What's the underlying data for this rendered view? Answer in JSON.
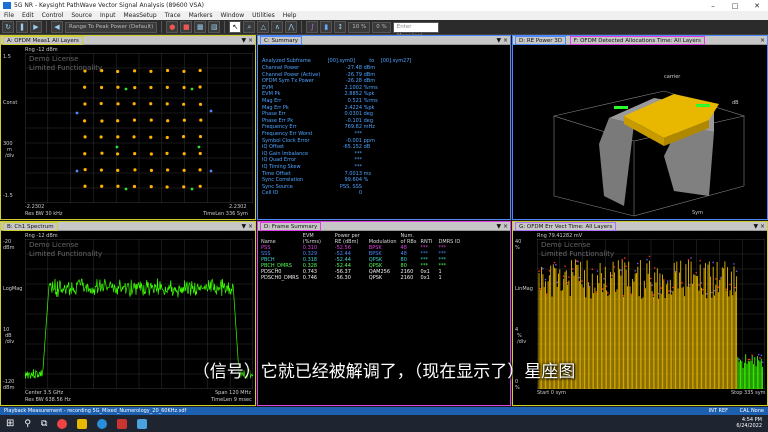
{
  "window": {
    "title": "5G NR - Keysight PathWave Vector Signal Analysis (89600 VSA)"
  },
  "menu": [
    "File",
    "Edit",
    "Control",
    "Source",
    "Input",
    "MeasSetup",
    "Trace",
    "Markers",
    "Window",
    "Utilities",
    "Help"
  ],
  "toolbar": {
    "range_label": "Range To Peak Power (Default)",
    "pct": "10 %",
    "zoom": "0 %",
    "search_placeholder": "Enter Meas/ical"
  },
  "panes": {
    "a": {
      "title": "A: OFDM Meas1 All Layers",
      "rng": "Rng -12 dBm",
      "license1": "Demo License",
      "license2": "Limited Functionality",
      "y_top": "1.5",
      "y_mid_top": "Const",
      "y_mid_val": "300",
      "y_mid_unit": "m",
      "y_mid_unit2": "/div",
      "y_bot": "-1.5",
      "x_left": "-2.2302",
      "x_right": "2.2302",
      "res": "Res BW 30 kHz",
      "timelen": "TimeLen 336  Sym"
    },
    "b": {
      "title": "B: Ch1 Spectrum",
      "rng": "Rng -12 dBm",
      "license1": "Demo License",
      "license2": "Limited Functionality",
      "y_top": "-20",
      "y_top_unit": "dBm",
      "y_mid": "LogMag",
      "y_mid_val": "10",
      "y_mid_unit": "dB",
      "y_mid_unit2": "/div",
      "y_bot": "-120",
      "y_bot_unit": "dBm",
      "center": "Center 3.5 GHz",
      "res": "Res BW 638.56 Hz",
      "span": "Span 120 MHz",
      "timelen": "TimeLen 9 msec"
    },
    "c": {
      "title": "C: Summary"
    },
    "d_title": "D: RE Power 3D",
    "f_title": "F: OFDM Detected Allocations Time: All Layers",
    "d": {
      "title": "D: Frame Summary"
    },
    "g": {
      "title": "G: OFDM Err Vect Time: All Layers",
      "rng": "Rng 79.41282 mV",
      "license1": "Demo License",
      "license2": "Limited Functionality",
      "y_top": "40",
      "y_top_unit": "%",
      "y_mid": "LinMag",
      "y_mid_val": "4",
      "y_mid_unit": "%",
      "y_mid_unit2": "/div",
      "y_bot": "0",
      "y_bot_unit": "%",
      "start": "Start 0  sym",
      "stop": "Stop 335  sym"
    }
  },
  "summary": {
    "header": {
      "label": "Analyzed  Subframe",
      "v1": "[00].sym0]",
      "v2": "to",
      "v3": "[00].sym27]"
    },
    "rows": [
      {
        "label": "Channel  Power",
        "value": "-27.48",
        "unit": "dBm"
      },
      {
        "label": "Channel  Power (Active)",
        "value": "-26.79",
        "unit": "dBm"
      },
      {
        "label": "OFDM Sym  Tx  Power",
        "value": "-26.28",
        "unit": "dBm"
      },
      {
        "label": "EVM",
        "value": "2.1002",
        "unit": "%rms"
      },
      {
        "label": "EVM Pk",
        "value": "2.8852",
        "unit": "%pk"
      },
      {
        "label": "Mag Err",
        "value": "0.521",
        "unit": "%rms"
      },
      {
        "label": "Mag Err  Pk",
        "value": "2.4224",
        "unit": "%pk"
      },
      {
        "label": "Phase  Err",
        "value": "0.0301",
        "unit": "deg"
      },
      {
        "label": "Phase  Err  Pk",
        "value": "-0.101",
        "unit": "deg"
      },
      {
        "label": "Frequency   Err",
        "value": "769.82",
        "unit": "mHz"
      },
      {
        "label": "Frequency   Err  Worst",
        "value": "***",
        "unit": ""
      },
      {
        "label": "Symbol  Clock  Error",
        "value": "-0.001",
        "unit": "ppm"
      },
      {
        "label": "IQ  Offset",
        "value": "-65.152",
        "unit": "dB"
      },
      {
        "label": "IQ  Gain  Imbalance",
        "value": "***",
        "unit": ""
      },
      {
        "label": "IQ  Quad  Error",
        "value": "***",
        "unit": ""
      },
      {
        "label": "IQ  Timing  Skew",
        "value": "***",
        "unit": ""
      },
      {
        "label": "Time  Offset",
        "value": "7.0013",
        "unit": "ms"
      },
      {
        "label": "Sync  Correlation",
        "value": "99.604",
        "unit": "%"
      },
      {
        "label": "Sync  Source",
        "value": "PSS,  SSS",
        "unit": ""
      },
      {
        "label": "Cell   ID",
        "value": "0",
        "unit": ""
      }
    ]
  },
  "frame_summary": {
    "headers": [
      "Name",
      "EVM (%rms)",
      "Power per RE (dBm)",
      "Modulation",
      "Num. of RBs",
      "RNTI",
      "DMRS ID"
    ],
    "rows": [
      {
        "name": "PSS",
        "evm": "0.310",
        "power": "-52.56",
        "mod": "BPSK",
        "rbs": "48",
        "rnti": "***",
        "dmrs": "***",
        "color": "#e040e0"
      },
      {
        "name": "SSS",
        "evm": "0.329",
        "power": "-52.44",
        "mod": "BPSK",
        "rbs": "48",
        "rnti": "***",
        "dmrs": "***",
        "color": "#4d88ff"
      },
      {
        "name": "PBCH",
        "evm": "0.318",
        "power": "-52.44",
        "mod": "QPSK",
        "rbs": "80",
        "rnti": "***",
        "dmrs": "***",
        "color": "#40d0d0"
      },
      {
        "name": "PBCH_DMRS",
        "evm": "0.328",
        "power": "-52.44",
        "mod": "QPSK",
        "rbs": "80",
        "rnti": "***",
        "dmrs": "***",
        "color": "#50ff50"
      },
      {
        "name": "PDSCH0",
        "evm": "0.743",
        "power": "-56.37",
        "mod": "QAM256",
        "rbs": "2160",
        "rnti": "0x1",
        "dmrs": "1",
        "color": "#f0f0f0"
      },
      {
        "name": "PDSCH0_DMRS",
        "evm": "0.746",
        "power": "-56.30",
        "mod": "QPSK",
        "rbs": "2160",
        "rnti": "0x1",
        "dmrs": "1",
        "color": "#f0f0f0"
      }
    ]
  },
  "status": {
    "left": "Playback Measurement - recording 5G_Mixed_Numerology_20_60KHz.sdf",
    "ext_ref": "INT REF",
    "cal": "CAL None"
  },
  "clock": {
    "time": "4:54 PM",
    "date": "6/24/2022"
  },
  "subtitle": "（信号）它就已经被解调了，（现在显示了）星座图",
  "colors": {
    "accent": "#1e60b0",
    "trace": "#3cff00",
    "constellation": "#ffb000"
  }
}
